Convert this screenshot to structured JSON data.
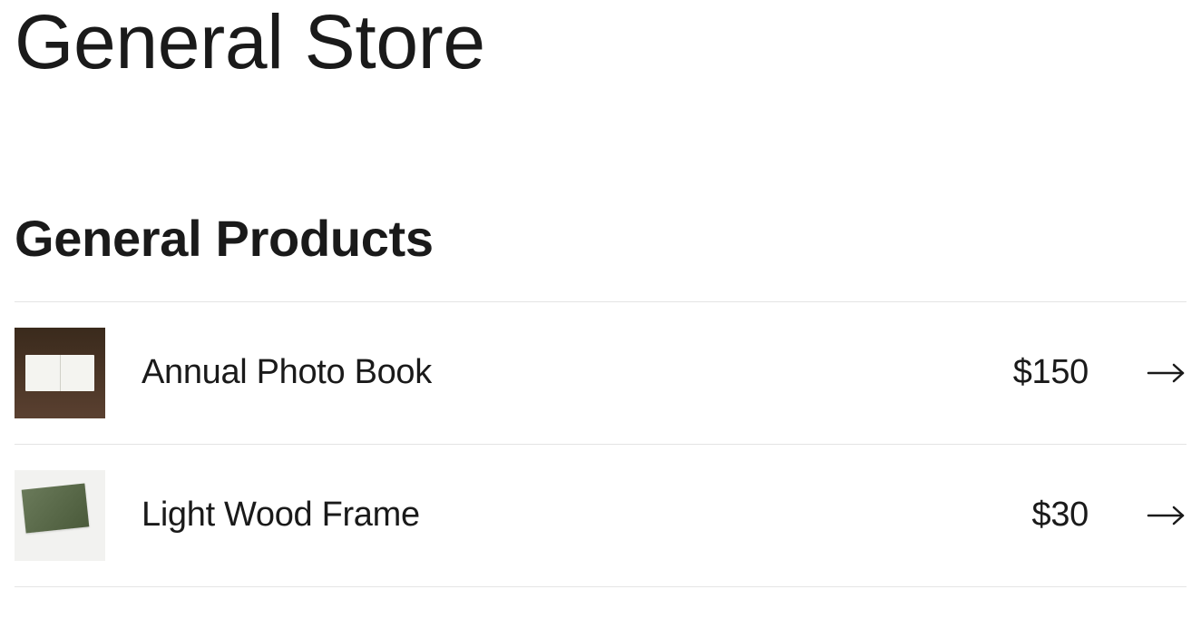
{
  "page": {
    "title": "General Store"
  },
  "section": {
    "title": "General Products"
  },
  "products": [
    {
      "name": "Annual Photo Book",
      "price": "$150",
      "thumb": "book"
    },
    {
      "name": "Light Wood Frame",
      "price": "$30",
      "thumb": "frame"
    }
  ]
}
